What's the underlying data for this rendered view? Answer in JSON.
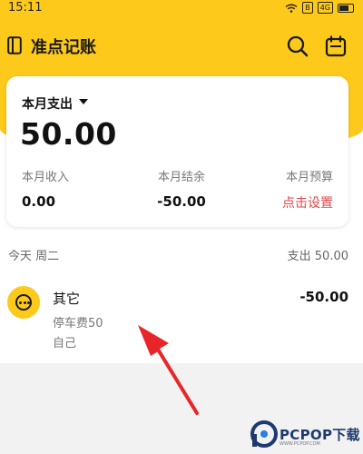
{
  "status_bar": {
    "time": "15:11",
    "sim_badge": "B",
    "signal_badge": "4G"
  },
  "app_bar": {
    "title": "准点记账"
  },
  "summary_card": {
    "selector_label": "本月支出",
    "expense_amount": "50.00",
    "income_label": "本月收入",
    "income_value": "0.00",
    "balance_label": "本月结余",
    "balance_value": "-50.00",
    "budget_label": "本月预算",
    "budget_action": "点击设置"
  },
  "day_group": {
    "date_label": "今天 周二",
    "total_label": "支出 50.00"
  },
  "record": {
    "category": "其它",
    "note": "停车费50",
    "member": "自己",
    "amount": "-50.00",
    "icon": "more-dots-icon"
  },
  "watermark": {
    "brand": "PCPOP下载",
    "tagline": "WWW.PCPOP.COM"
  },
  "colors": {
    "brand_yellow": "#fdc91a",
    "link_red": "#e0464d",
    "arrow_red": "#e8262a"
  }
}
